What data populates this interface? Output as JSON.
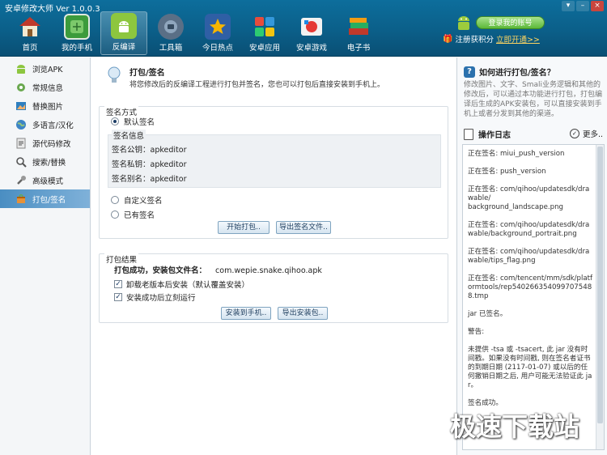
{
  "window": {
    "title": "安卓修改大师 Ver 1.0.0.3"
  },
  "nav": [
    {
      "label": "首页",
      "icon": "house-icon"
    },
    {
      "label": "我的手机",
      "icon": "phone-icon"
    },
    {
      "label": "反编译",
      "icon": "android-robot-icon"
    },
    {
      "label": "工具箱",
      "icon": "toolbox-icon"
    },
    {
      "label": "今日热点",
      "icon": "star-icon"
    },
    {
      "label": "安卓应用",
      "icon": "apps-grid-icon"
    },
    {
      "label": "安卓游戏",
      "icon": "game-icon"
    },
    {
      "label": "电子书",
      "icon": "books-icon"
    }
  ],
  "promo": {
    "login_label": "登录我的账号",
    "register_text": "注册获积分",
    "register_link": "立即开通>>"
  },
  "sidebar": [
    {
      "label": "浏览APK"
    },
    {
      "label": "常规信息"
    },
    {
      "label": "替换图片"
    },
    {
      "label": "多语言/汉化"
    },
    {
      "label": "源代码修改"
    },
    {
      "label": "搜索/替换"
    },
    {
      "label": "高级模式"
    },
    {
      "label": "打包/签名"
    }
  ],
  "main": {
    "title": "打包/签名",
    "desc": "将您修改后的反编译工程进行打包并签名，您也可以打包后直接安装到手机上。",
    "sign_group_label": "签名方式",
    "default_sign_label": "默认签名",
    "sign_info_label": "签名信息",
    "sign_info": [
      "签名公钥：apkeditor",
      "签名私钥：apkeditor",
      "签名别名：apkeditor"
    ],
    "custom_sign_label": "自定义签名",
    "existing_sign_label": "已有签名",
    "start_pack_btn": "开始打包..",
    "export_sign_btn": "导出签名文件..",
    "result_group_label": "打包结果",
    "result_label": "打包成功，安装包文件名：",
    "result_file": "com.wepie.snake.qihoo.apk",
    "uninstall_label": "卸载老版本后安装（默认覆盖安装）",
    "autorun_label": "安装成功后立刻运行",
    "install_btn": "安装到手机..",
    "export_pkg_btn": "导出安装包.."
  },
  "right": {
    "howto_title": "如何进行打包/签名？",
    "howto_desc": "修改图片、文字、Smali业务逻辑和其他的修改后，可以通过本功能进行打包，打包编译后生成的APK安装包，可以直接安装到手机上或者分发到其他的渠道。",
    "log_title": "操作日志",
    "more_label": "更多..",
    "log_entries": [
      "正在签名: miui_push_version",
      "正在签名: push_version",
      "正在签名: com/qihoo/updatesdk/drawable/\nbackground_landscape.png",
      "正在签名: com/qihoo/updatesdk/drawable/background_portrait.png",
      "正在签名: com/qihoo/updatesdk/drawable/tips_flag.png",
      "正在签名: com/tencent/mm/sdk/platformtools/rep5402663540997075488.tmp",
      "jar 已签名。",
      "警告:",
      "未提供 -tsa 或 -tsacert, 此 jar 没有时间戳。如果没有时间戳, 则在签名者证书的到期日期 (2117-01-07) 或以后的任何撤销日期之后, 用户可能无法验证此 jar。",
      "签名成功。"
    ]
  },
  "watermark": "极速下载站",
  "colors": {
    "header": "#0b5f89",
    "active": "#4a8ec2"
  }
}
